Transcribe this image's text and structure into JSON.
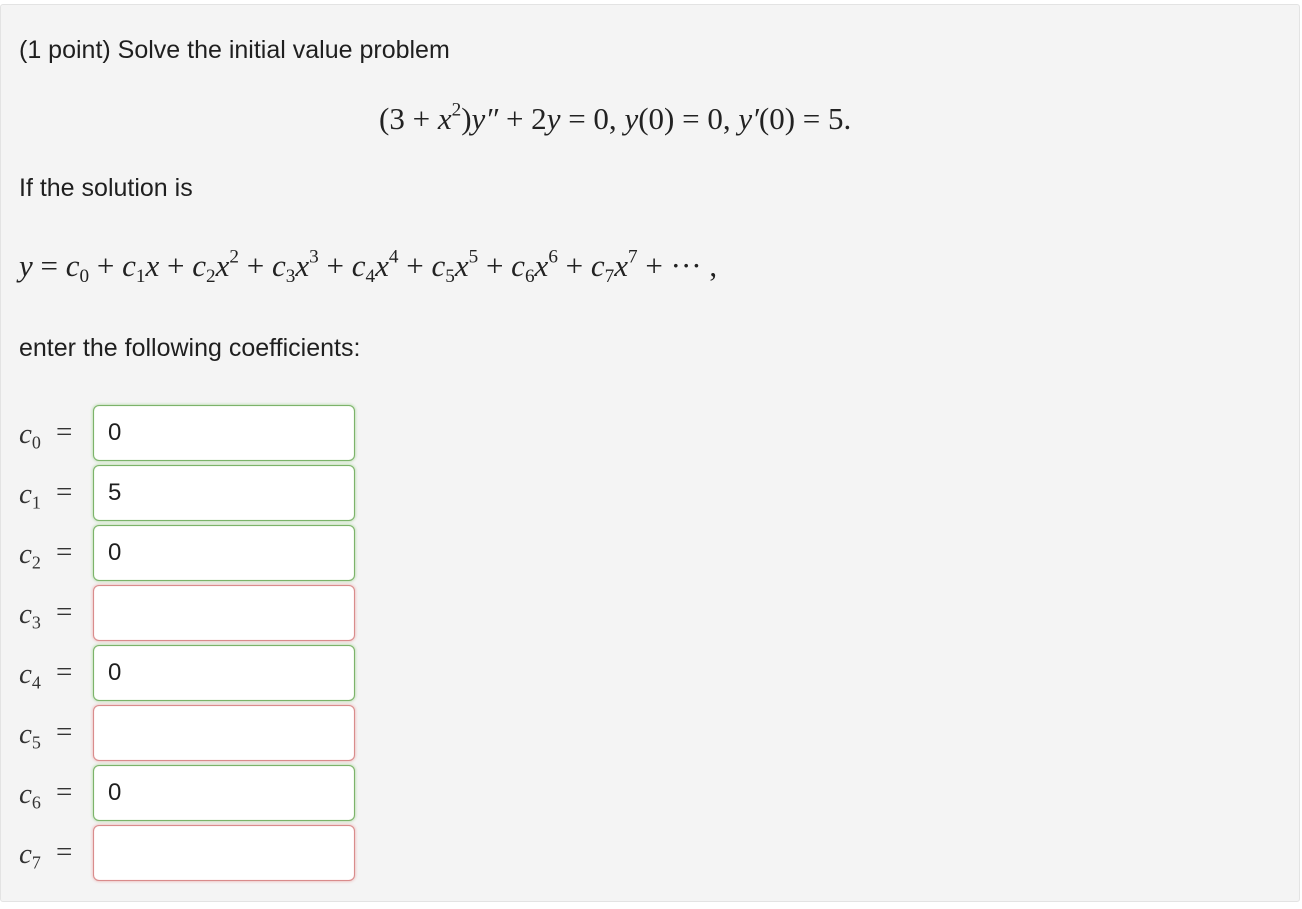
{
  "problem": {
    "title": "(1 point) Solve the initial value problem",
    "equation": {
      "lhs_open": "(3 + ",
      "x": "x",
      "x_exp": "2",
      "mid": ")",
      "y": "y",
      "yprime2": "″",
      "rest1": " + 2",
      "y2": "y",
      "rest2": " = 0,  ",
      "y3": "y",
      "rest3": "(0) = 0,  ",
      "y4": "y",
      "yprime": "′",
      "rest4": "(0) = 5."
    },
    "solution_intro": "If the solution is",
    "series_text": "y = c0 + c1x + c2x2 + c3x3 + c4x4 + c5x5 + c6x6 + c7x7 + ··· ,",
    "enter_prompt": "enter the following coefficients:"
  },
  "coefficients": [
    {
      "symbol": "c",
      "index": "0",
      "value": "0",
      "status": "correct"
    },
    {
      "symbol": "c",
      "index": "1",
      "value": "5",
      "status": "correct"
    },
    {
      "symbol": "c",
      "index": "2",
      "value": "0",
      "status": "correct"
    },
    {
      "symbol": "c",
      "index": "3",
      "value": "",
      "status": "incorrect"
    },
    {
      "symbol": "c",
      "index": "4",
      "value": "0",
      "status": "correct"
    },
    {
      "symbol": "c",
      "index": "5",
      "value": "",
      "status": "incorrect"
    },
    {
      "symbol": "c",
      "index": "6",
      "value": "0",
      "status": "correct"
    },
    {
      "symbol": "c",
      "index": "7",
      "value": "",
      "status": "incorrect"
    }
  ],
  "equals_sign": "=",
  "colors": {
    "correct_border": "#7cb36a",
    "incorrect_border": "#d98c8c",
    "panel_bg": "#f4f4f4"
  }
}
